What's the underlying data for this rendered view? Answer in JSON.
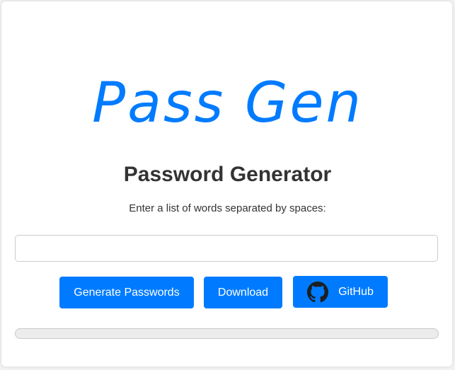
{
  "app": {
    "logo_text": "Pass Gen",
    "title": "Password Generator",
    "instruction": "Enter a list of words separated by spaces:"
  },
  "input": {
    "value": "",
    "placeholder": ""
  },
  "buttons": {
    "generate_label": "Generate Passwords",
    "download_label": "Download",
    "github_label": "GitHub",
    "github_icon": "github-icon"
  },
  "progress": {
    "value_percent": 0
  },
  "colors": {
    "accent": "#007bff",
    "text": "#333333",
    "background": "#ffffff"
  }
}
